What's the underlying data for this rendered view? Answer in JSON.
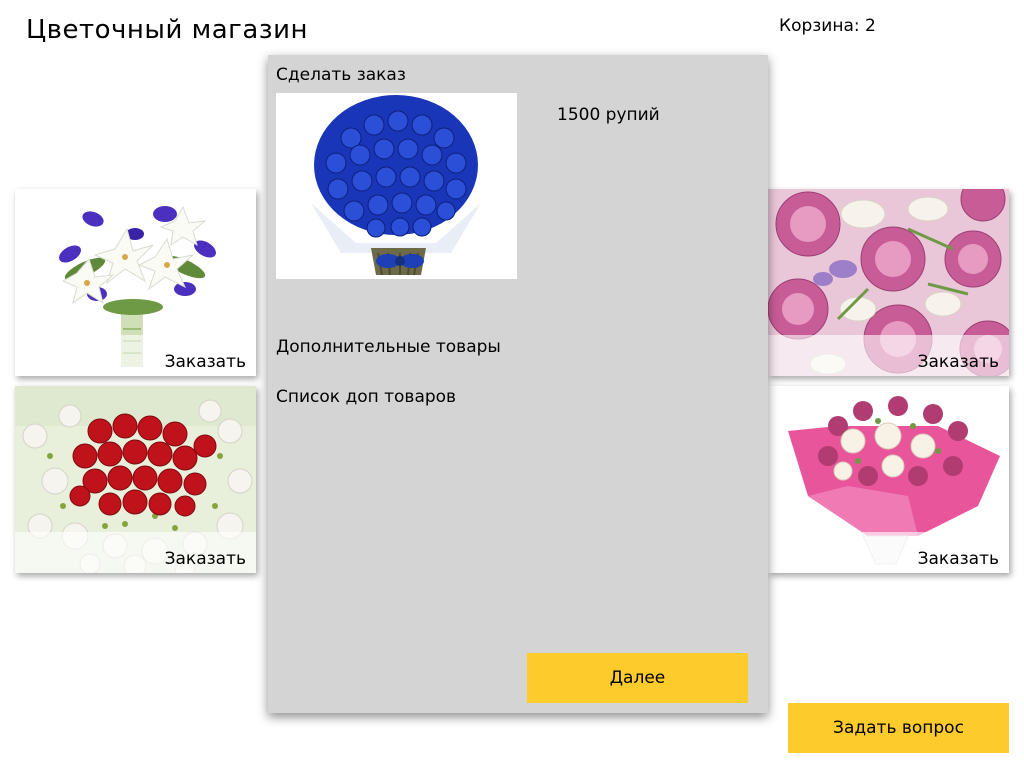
{
  "header": {
    "shop_title": "Цветочный магазин",
    "cart_counter": "Корзина: 2"
  },
  "catalog": {
    "cards": [
      {
        "bouquet": "white lilies and blue irises",
        "order_label": "Заказать"
      },
      {
        "bouquet": "red roses with white flowers",
        "order_label": "Заказать"
      },
      {
        "bouquet": "pink roses with freesia",
        "order_label": "Заказать"
      },
      {
        "bouquet": "pink chrysanthemums and white roses in pink wrap",
        "order_label": "Заказать"
      }
    ]
  },
  "order_modal": {
    "title": "Сделать заказ",
    "bouquet": "blue roses",
    "price": "1500 рупий",
    "extras_heading": "Дополнительные товары",
    "extras_list": "Список доп товаров",
    "next_label": "Далее"
  },
  "footer": {
    "ask_label": "Задать вопрос"
  },
  "colors": {
    "accent": "#fdcb2c",
    "modal_background": "#d4d4d4",
    "page_background": "#ffffff"
  }
}
